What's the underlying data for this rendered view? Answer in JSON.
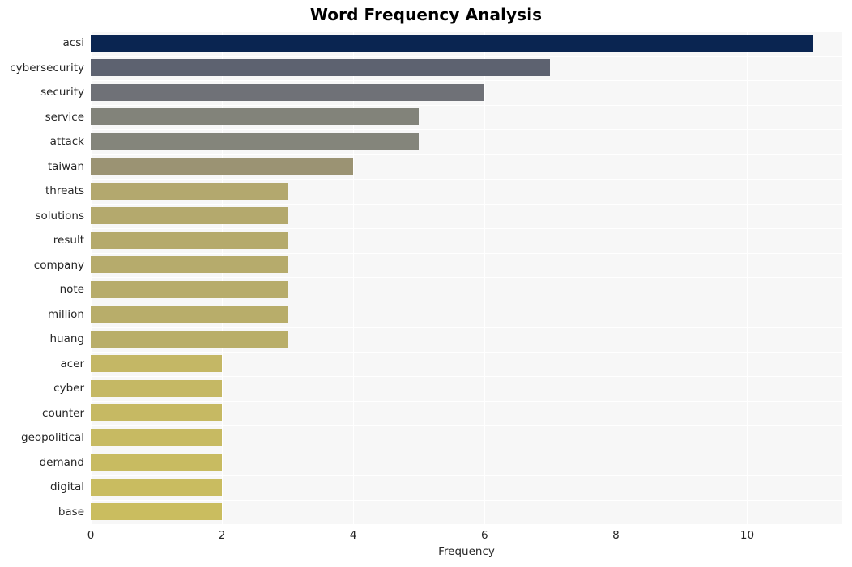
{
  "chart_data": {
    "type": "bar",
    "orientation": "horizontal",
    "title": "Word Frequency Analysis",
    "xlabel": "Frequency",
    "ylabel": "",
    "categories": [
      "acsi",
      "cybersecurity",
      "security",
      "service",
      "attack",
      "taiwan",
      "threats",
      "solutions",
      "result",
      "company",
      "note",
      "million",
      "huang",
      "acer",
      "cyber",
      "counter",
      "geopolitical",
      "demand",
      "digital",
      "base"
    ],
    "values": [
      11,
      7,
      6,
      5,
      5,
      4,
      3,
      3,
      3,
      3,
      3,
      3,
      3,
      2,
      2,
      2,
      2,
      2,
      2,
      2
    ],
    "bar_colors": [
      "#0a2551",
      "#5d6270",
      "#6f7177",
      "#82837a",
      "#84857b",
      "#9b9373",
      "#b3a86e",
      "#b4a96d",
      "#b5aa6c",
      "#b6ab6c",
      "#b7ac6b",
      "#b8ad6a",
      "#b9ae69",
      "#c4b765",
      "#c5b864",
      "#c6b963",
      "#c7ba62",
      "#c8bb61",
      "#c9bc60",
      "#cabd5f"
    ],
    "xlim": [
      0,
      11.45
    ],
    "xticks": [
      0,
      2,
      4,
      6,
      8,
      10
    ],
    "xtick_labels": [
      "0",
      "2",
      "4",
      "6",
      "8",
      "10"
    ],
    "grid": "both",
    "legend": "none",
    "plot_background": "#f7f7f7",
    "gridline_color": "#ffffff",
    "figure_background": "#ffffff",
    "text_color": "#262626"
  }
}
